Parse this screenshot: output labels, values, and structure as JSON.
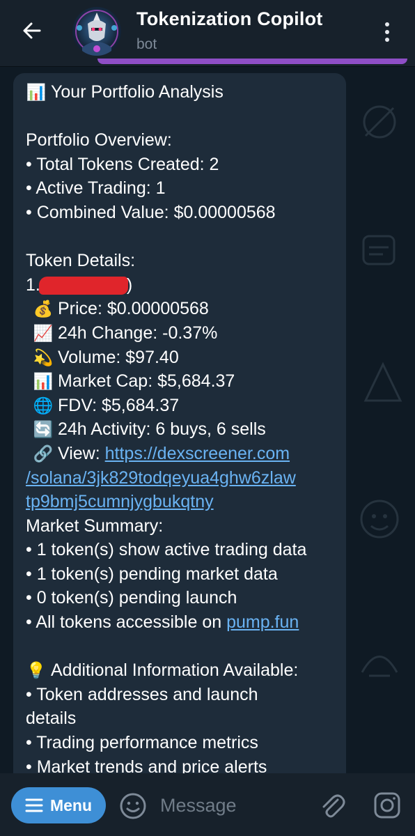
{
  "header": {
    "title": "Tokenization Copilot",
    "subtitle": "bot",
    "back_icon": "arrow-left-icon",
    "more_icon": "vertical-dots-icon"
  },
  "message": {
    "lines": [
      {
        "type": "heading",
        "emoji": "📊",
        "text": "Your Portfolio Analysis"
      },
      {
        "type": "blank"
      },
      {
        "type": "text",
        "text": "Portfolio Overview:"
      },
      {
        "type": "text",
        "text": "• Total Tokens Created: 2"
      },
      {
        "type": "text",
        "text": "• Active Trading: 1"
      },
      {
        "type": "text",
        "text": "• Combined Value: $0.00000568"
      },
      {
        "type": "blank"
      },
      {
        "type": "text",
        "text": "Token Details:"
      },
      {
        "type": "redacted",
        "prefix": "1.",
        "suffix": ")"
      },
      {
        "type": "detail",
        "emoji": "💰",
        "text": "Price: $0.00000568"
      },
      {
        "type": "detail",
        "emoji": "📈",
        "text": "24h Change: -0.37%"
      },
      {
        "type": "detail",
        "emoji": "💫",
        "text": "Volume: $97.40"
      },
      {
        "type": "detail",
        "emoji": "📊",
        "text": "Market Cap: $5,684.37"
      },
      {
        "type": "detail",
        "emoji": "🌐",
        "text": "FDV: $5,684.37"
      },
      {
        "type": "detail",
        "emoji": "🔄",
        "text": "24h Activity: 6 buys, 6 sells"
      },
      {
        "type": "detail-link",
        "emoji": "🔗",
        "text": "View: ",
        "link": "https://dexscreener.com"
      },
      {
        "type": "link",
        "link": "/solana/3jk829todqeyua4ghw6zlaw"
      },
      {
        "type": "link",
        "link": "tp9bmj5cumnjygbukqtny"
      },
      {
        "type": "text",
        "text": "Market Summary:"
      },
      {
        "type": "text",
        "text": "• 1 token(s) show active trading data"
      },
      {
        "type": "text",
        "text": "• 1 token(s) pending market data"
      },
      {
        "type": "text",
        "text": "• 0 token(s) pending launch"
      },
      {
        "type": "text-link",
        "text": "• All tokens accessible on ",
        "link": "pump.fun"
      },
      {
        "type": "blank"
      },
      {
        "type": "heading",
        "emoji": "💡",
        "text": "Additional Information Available:"
      },
      {
        "type": "text",
        "text": "• Token addresses and launch"
      },
      {
        "type": "text",
        "text": "details"
      },
      {
        "type": "text",
        "text": "• Trading performance metrics"
      },
      {
        "type": "text",
        "text": "• Market trends and price alerts"
      }
    ]
  },
  "input_bar": {
    "menu_label": "Menu",
    "placeholder": "Message",
    "icons": [
      "emoji-icon",
      "paperclip-icon",
      "camera-icon"
    ]
  },
  "colors": {
    "header_bg": "#17212b",
    "chat_bg": "#0f1a24",
    "bubble_bg": "#1e2c3a",
    "link": "#6ab3f3",
    "menu_button": "#3e8fd6",
    "accent_purple": "#8e4ec6"
  }
}
